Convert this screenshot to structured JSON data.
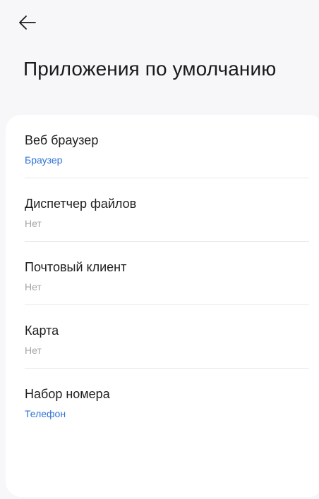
{
  "header": {
    "back_icon": "arrow-left-icon",
    "title": "Приложения по умолчанию"
  },
  "colors": {
    "accent": "#2f73d6",
    "muted": "#a4a4a8",
    "background": "#f7f7f9",
    "card": "#ffffff"
  },
  "items": [
    {
      "title": "Веб браузер",
      "value": "Браузер",
      "value_style": "accent"
    },
    {
      "title": "Диспетчер файлов",
      "value": "Нет",
      "value_style": "muted"
    },
    {
      "title": "Почтовый клиент",
      "value": "Нет",
      "value_style": "muted"
    },
    {
      "title": "Карта",
      "value": "Нет",
      "value_style": "muted"
    },
    {
      "title": "Набор номера",
      "value": "Телефон",
      "value_style": "accent"
    }
  ]
}
